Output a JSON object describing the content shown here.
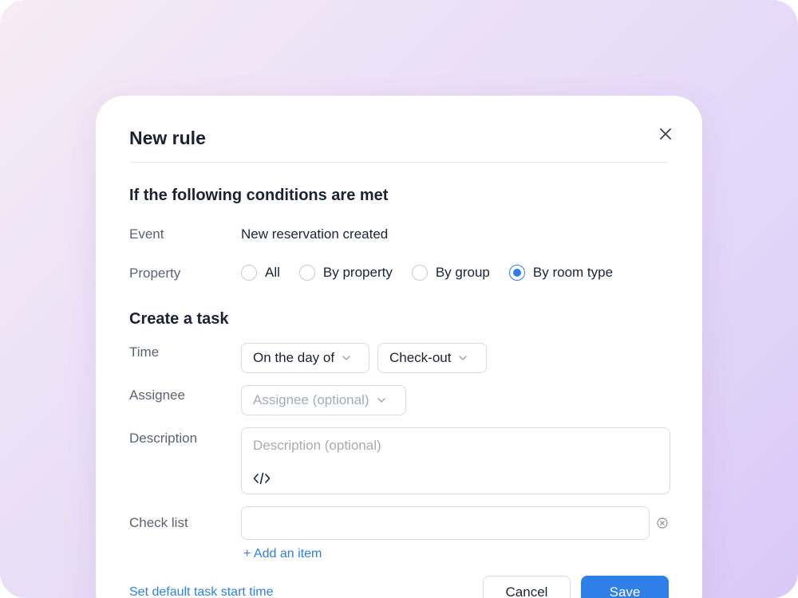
{
  "modal": {
    "title": "New rule",
    "close_icon": "close-icon"
  },
  "conditions": {
    "heading": "If the following conditions are met",
    "event_label": "Event",
    "event_value": "New reservation created",
    "property_label": "Property",
    "property_options": [
      {
        "label": "All",
        "checked": false
      },
      {
        "label": "By property",
        "checked": false
      },
      {
        "label": "By group",
        "checked": false
      },
      {
        "label": "By room type",
        "checked": true
      }
    ]
  },
  "task": {
    "heading": "Create a task",
    "time_label": "Time",
    "time_when": "On the day of",
    "time_event": "Check-out",
    "assignee_label": "Assignee",
    "assignee_placeholder": "Assignee (optional)",
    "description_label": "Description",
    "description_placeholder": "Description (optional)",
    "checklist_label": "Check list",
    "checklist_value": "",
    "add_item": "+ Add an item"
  },
  "footer": {
    "default_time_link": "Set default task start time",
    "cancel": "Cancel",
    "save": "Save"
  },
  "colors": {
    "accent": "#2f7fe8",
    "text": "#1b2333",
    "muted": "#5b6272"
  }
}
